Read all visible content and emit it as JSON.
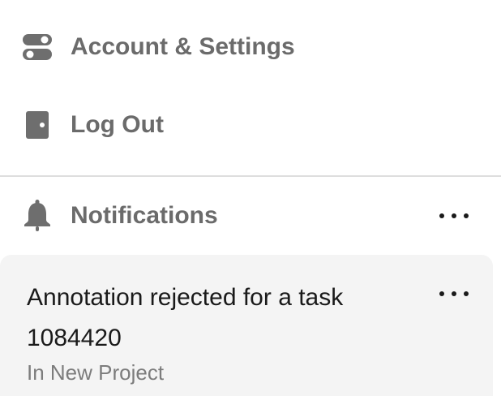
{
  "menu": {
    "account": {
      "label": "Account & Settings",
      "icon": "toggle-settings-icon"
    },
    "logout": {
      "label": "Log Out",
      "icon": "door-icon"
    }
  },
  "notifications": {
    "header_label": "Notifications",
    "header_icon": "bell-icon",
    "items": [
      {
        "title": "Annotation rejected for a task 1084420",
        "subtitle": "In New Project"
      }
    ]
  },
  "colors": {
    "label_gray": "#6b6b6b",
    "icon_gray": "#6e6e6e",
    "card_bg": "#f4f4f4",
    "divider": "#dedede",
    "text_dark": "#1a1a1a"
  }
}
